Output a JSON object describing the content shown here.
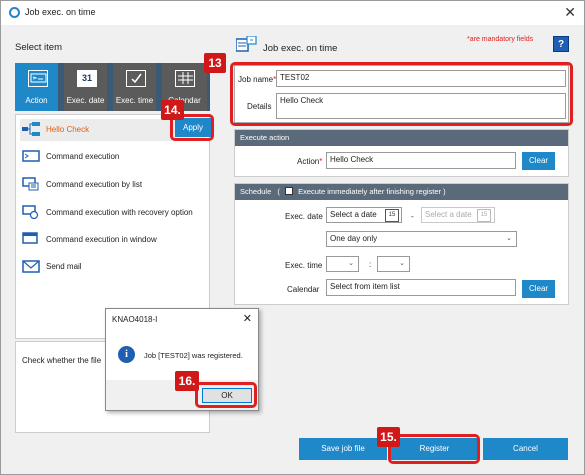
{
  "window": {
    "title": "Job exec. on time",
    "close_glyph": "✕"
  },
  "left_panel": {
    "heading": "Select item",
    "tabs": [
      {
        "label": "Action",
        "icon": "action-icon",
        "active": true
      },
      {
        "label": "Exec. date",
        "icon": "calendar-31-icon",
        "day": "31"
      },
      {
        "label": "Exec. time",
        "icon": "clock-check-icon"
      },
      {
        "label": "Calendar",
        "icon": "calendar-grid-icon"
      }
    ],
    "items": [
      {
        "label": "Hello Check",
        "icon": "job-flow-icon",
        "selected": true
      },
      {
        "label": "Command execution",
        "icon": "command-icon"
      },
      {
        "label": "Command execution by list",
        "icon": "command-list-icon"
      },
      {
        "label": "Command execution with recovery option",
        "icon": "command-recovery-icon"
      },
      {
        "label": "Command execution in window",
        "icon": "command-window-icon"
      },
      {
        "label": "Send mail",
        "icon": "mail-icon"
      }
    ],
    "apply_label": "Apply",
    "description": "Check whether the file"
  },
  "right_panel": {
    "title": "Job exec. on time",
    "mandatory_note": "*are mandatory fields",
    "help_label": "?",
    "job_name_label": "Job name",
    "job_name_value": "TEST02",
    "details_label": "Details",
    "details_value": "Hello Check",
    "execute_action": {
      "heading": "Execute action",
      "action_label": "Action",
      "action_value": "Hello Check",
      "clear_label": "Clear"
    },
    "schedule": {
      "heading": "Schedule",
      "immediate_label": "Execute immediately after finishing register",
      "immediate_checked": false,
      "exec_date_label": "Exec. date",
      "date_from_placeholder": "Select a date",
      "date_to_placeholder": "Select a date",
      "date_separator": "-",
      "cal_icon_text": "15",
      "repeat_value": "One day only",
      "exec_time_label": "Exec. time",
      "time_separator": ":",
      "calendar_label": "Calendar",
      "calendar_value": "Select from item list",
      "clear_label": "Clear"
    }
  },
  "footer": {
    "save_label": "Save job file",
    "register_label": "Register",
    "cancel_label": "Cancel"
  },
  "dialog": {
    "title": "KNAO4018-I",
    "message": "Job [TEST02] was registered.",
    "ok_label": "OK",
    "info_glyph": "i",
    "close_glyph": "✕"
  },
  "annotations": [
    {
      "badge": "13"
    },
    {
      "badge": "14."
    },
    {
      "badge": "15."
    },
    {
      "badge": "16."
    }
  ],
  "colors": {
    "accent": "#1e88c8",
    "highlight": "#e02020",
    "section_header": "#5a6a7a",
    "selected_text": "#e06010"
  }
}
